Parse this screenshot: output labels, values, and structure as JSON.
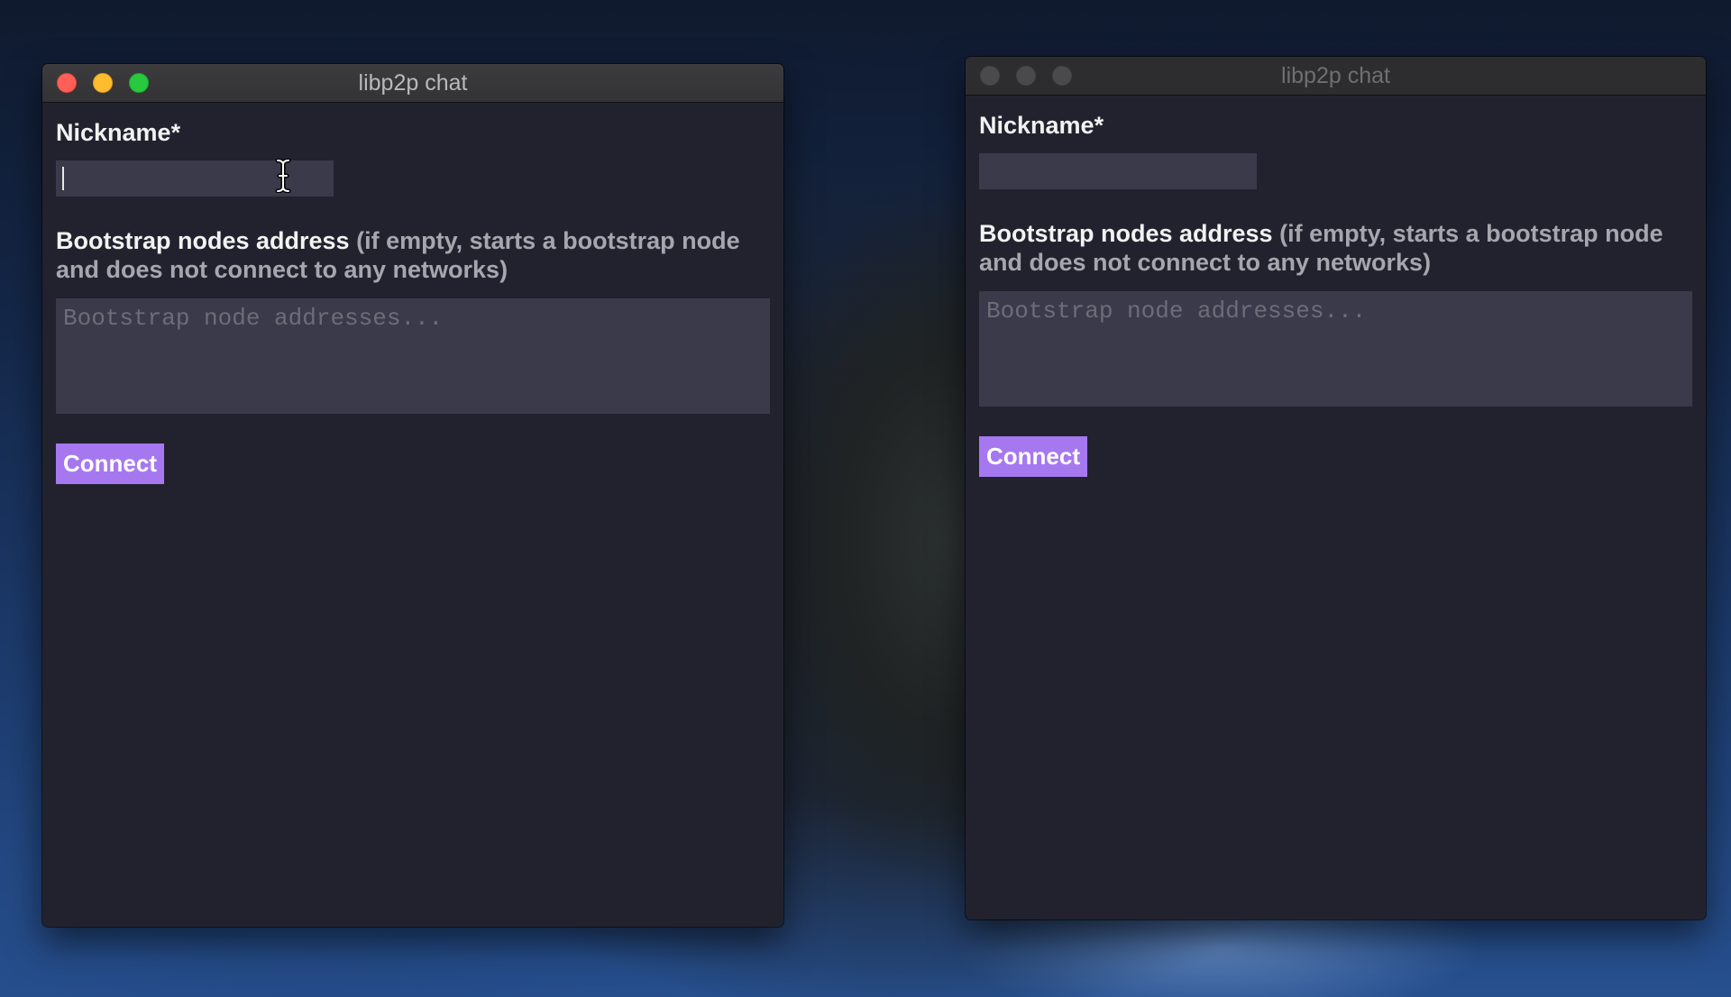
{
  "windows": [
    {
      "title": "libp2p chat",
      "active": true,
      "nickname_label": "Nickname*",
      "nickname_value": "",
      "bootstrap_label": "Bootstrap nodes address",
      "bootstrap_hint": "(if empty, starts a bootstrap node and does not connect to any networks)",
      "bootstrap_placeholder": "Bootstrap node addresses...",
      "connect_label": "Connect"
    },
    {
      "title": "libp2p chat",
      "active": false,
      "nickname_label": "Nickname*",
      "nickname_value": "",
      "bootstrap_label": "Bootstrap nodes address",
      "bootstrap_hint": "(if empty, starts a bootstrap node and does not connect to any networks)",
      "bootstrap_placeholder": "Bootstrap node addresses...",
      "connect_label": "Connect"
    }
  ],
  "colors": {
    "window_bg": "#22222f",
    "input_bg": "#3a3a4b",
    "button_bg": "#a678f0",
    "close": "#fe5f57",
    "minimize": "#febc2e",
    "maximize": "#28c840"
  },
  "icons": {
    "cursor": "text-cursor-ibeam-icon"
  }
}
